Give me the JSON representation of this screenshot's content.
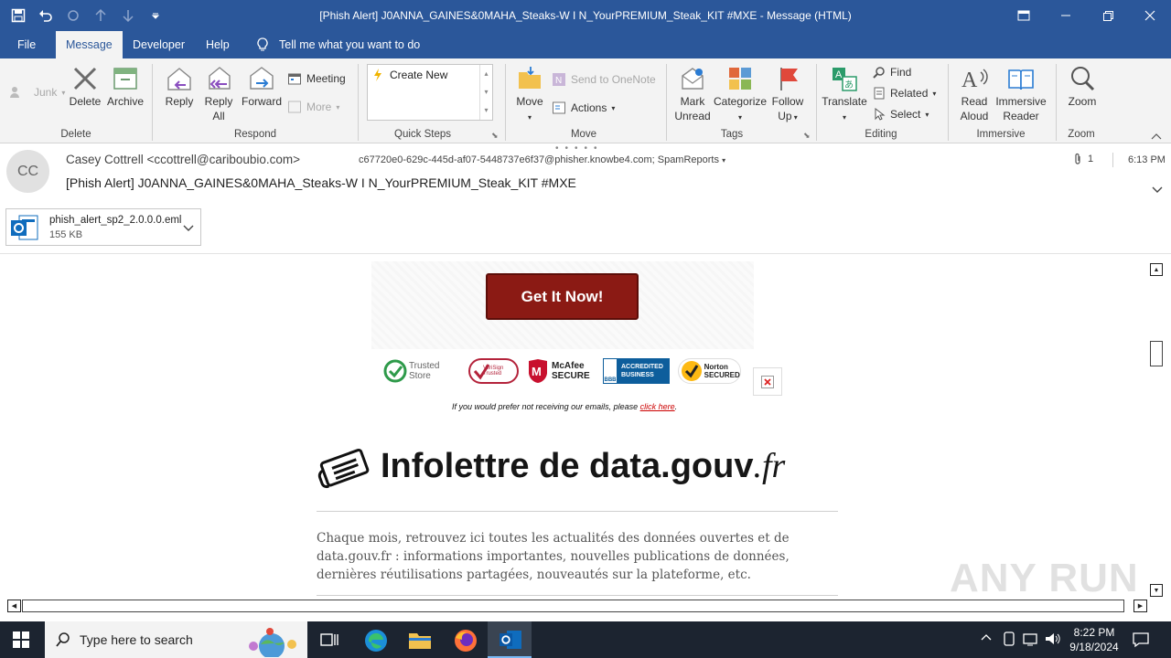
{
  "window": {
    "title": "[Phish Alert] J0ANNA_GAINES&0MAHA_Steaks-W I N_YourPREMIUM_Steak_KIT #MXE  -  Message (HTML)"
  },
  "menu": {
    "tabs": [
      "File",
      "Message",
      "Developer",
      "Help"
    ],
    "tell_me": "Tell me what you want to do"
  },
  "ribbon": {
    "junk": "Junk",
    "delete": "Delete",
    "archive": "Archive",
    "delete_group": "Delete",
    "reply": "Reply",
    "reply_all_1": "Reply",
    "reply_all_2": "All",
    "forward": "Forward",
    "meeting": "Meeting",
    "more": "More",
    "respond_group": "Respond",
    "create_new": "Create New",
    "quicksteps_group": "Quick Steps",
    "move": "Move",
    "send_onenote": "Send to OneNote",
    "actions": "Actions",
    "move_group": "Move",
    "mark_unread_1": "Mark",
    "mark_unread_2": "Unread",
    "categorize": "Categorize",
    "follow_up_1": "Follow",
    "follow_up_2": "Up",
    "tags_group": "Tags",
    "translate": "Translate",
    "find": "Find",
    "related": "Related",
    "select": "Select",
    "editing_group": "Editing",
    "read_aloud_1": "Read",
    "read_aloud_2": "Aloud",
    "immersive_1": "Immersive",
    "immersive_2": "Reader",
    "immersive_group": "Immersive",
    "zoom": "Zoom",
    "zoom_group": "Zoom"
  },
  "message": {
    "avatar": "CC",
    "from": "Casey Cottrell <ccottrell@cariboubio.com>",
    "to": "c67720e0-629c-445d-af07-5448737e6f37@phisher.knowbe4.com; SpamReports",
    "subject": "[Phish Alert] J0ANNA_GAINES&0MAHA_Steaks-W I N_YourPREMIUM_Steak_KIT  #MXE",
    "attachment_count": "1",
    "time": "6:13 PM",
    "attachment_name": "phish_alert_sp2_2.0.0.0.eml",
    "attachment_size": "155 KB"
  },
  "body": {
    "cta": "Get It Now!",
    "badges": [
      "Trusted Store",
      "VeriSign Trusted",
      "McAfee SECURE",
      "ACCREDITED BUSINESS",
      "Norton SECURED"
    ],
    "unsubscribe_text": "If you would prefer not receiving our emails, please ",
    "unsubscribe_link": "click here",
    "unsubscribe_end": ".",
    "newsletter_title_a": "Infolettre de data.gouv",
    "newsletter_title_b": ".fr",
    "newsletter_text": "Chaque mois, retrouvez ici toutes les actualités des données ouvertes et de data.gouv.fr : informations importantes, nouvelles publications de données, dernières réutilisations partagées, nouveautés sur la plateforme, etc.",
    "watermark": "ANY RUN"
  },
  "taskbar": {
    "search_placeholder": "Type here to search",
    "clock_time": "8:22 PM",
    "clock_date": "9/18/2024"
  },
  "colors": {
    "accent": "#2b579a",
    "cta": "#8b1a14",
    "link": "#cc0000"
  }
}
